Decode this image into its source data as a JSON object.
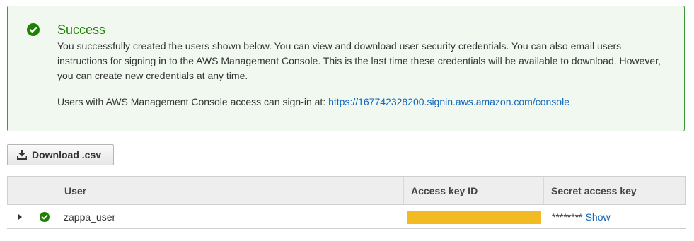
{
  "alert": {
    "status_color": "#1d8102",
    "icon": "check-circle-icon",
    "title": "Success",
    "message": "You successfully created the users shown below. You can view and download user security credentials. You can also email users instructions for signing in to the AWS Management Console. This is the last time these credentials will be available to download. However, you can create new credentials at any time.",
    "signin_prefix": "Users with AWS Management Console access can sign-in at:",
    "signin_url": "https://167742328200.signin.aws.amazon.com/console"
  },
  "toolbar": {
    "download_icon": "download-icon",
    "download_label": "Download .csv"
  },
  "table": {
    "columns": [
      "User",
      "Access key ID",
      "Secret access key"
    ],
    "rows": [
      {
        "expand_icon": "caret-right-icon",
        "status_icon": "check-circle-icon",
        "user": "zappa_user",
        "access_key_id_redacted": true,
        "secret_mask": "********",
        "secret_show_label": "Show"
      }
    ]
  },
  "colors": {
    "success": "#1d8102",
    "link": "#1166bb",
    "redaction": "#f3bb23"
  }
}
